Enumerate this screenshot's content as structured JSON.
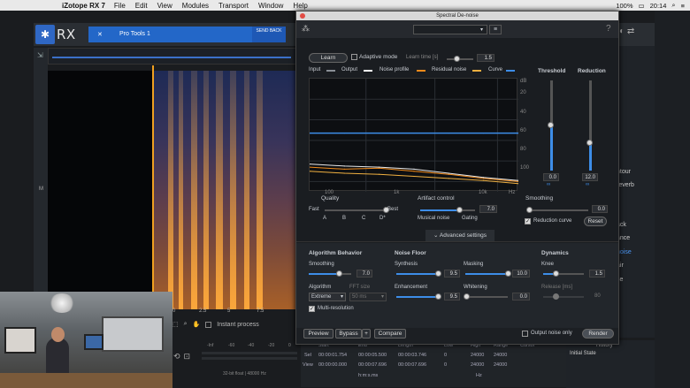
{
  "menubar": {
    "app": "iZotope RX 7",
    "items": [
      "File",
      "Edit",
      "View",
      "Modules",
      "Transport",
      "Window",
      "Help"
    ],
    "battery": "100%",
    "time": "20:14"
  },
  "rx": {
    "logo": "RX",
    "tab_close": "✕",
    "tab_name": "Pro Tools 1",
    "send_back": "SEND BACK",
    "track_label": "M",
    "timeline": [
      "0",
      "2.5",
      "5",
      "7.5",
      "10",
      "12.5",
      "15",
      "17.5",
      "20"
    ],
    "instant_process": "Instant process",
    "format": "32-bit float | 48000 Hz",
    "meter_labels": [
      "-Inf",
      "-60",
      "-40",
      "-20",
      "0"
    ]
  },
  "rightpanel": {
    "items": [
      "ntour",
      "reverb",
      "ack",
      "ance",
      "noise",
      "air",
      "se"
    ],
    "history_label": "History",
    "history_item": "Initial State",
    "cursor_label": "Cursor"
  },
  "selection": {
    "headers": [
      "Start",
      "End",
      "Length",
      "Low",
      "High",
      "Range"
    ],
    "sel": [
      "Sel",
      "00:00:01.754",
      "00:00:05.500",
      "00:00:03.746",
      "0",
      "24000",
      "24000"
    ],
    "view": [
      "View",
      "00:00:00.000",
      "00:00:07.696",
      "00:00:07.696",
      "0",
      "24000",
      "24000"
    ],
    "units": "h:m:s.ms",
    "hz": "Hz"
  },
  "dialog": {
    "title": "Spectral De-noise",
    "help": "?",
    "learn": "Learn",
    "adaptive": "Adaptive mode",
    "learn_time_label": "Learn time [s]",
    "learn_time": "1.5",
    "legend": [
      {
        "name": "Input",
        "color": "#8a8f96"
      },
      {
        "name": "Output",
        "color": "#ffffff"
      },
      {
        "name": "Noise profile",
        "color": "#f08a1a"
      },
      {
        "name": "Residual noise",
        "color": "#f0b040"
      },
      {
        "name": "Curve",
        "color": "#3d8de8"
      }
    ],
    "threshold_label": "Threshold",
    "threshold": "0.0",
    "reduction_label": "Reduction",
    "reduction": "12.0",
    "db_ticks": [
      "dB",
      "20",
      "40",
      "60",
      "80",
      "100"
    ],
    "hz_ticks": [
      "100",
      "1k",
      "10k",
      "Hz"
    ],
    "quality_label": "Quality",
    "fast": "Fast",
    "best": "Best",
    "quality_marks": [
      "A",
      "B",
      "C",
      "D*"
    ],
    "artifact_label": "Artifact control",
    "artifact": "7.0",
    "musical_noise": "Musical noise",
    "gating": "Gating",
    "smoothing_label": "Smoothing",
    "smoothing": "0.0",
    "reduction_curve": "Reduction curve",
    "reset": "Reset",
    "advanced": "Advanced settings",
    "alg_behavior": "Algorithm Behavior",
    "adv_smoothing": "Smoothing",
    "adv_smoothing_val": "7.0",
    "algorithm_label": "Algorithm",
    "algorithm": "Extreme",
    "fft_label": "FFT size",
    "fft": "50 ms",
    "multi_res": "Multi-resolution",
    "noise_floor": "Noise Floor",
    "synthesis": "Synthesis",
    "synthesis_val": "9.5",
    "masking": "Masking",
    "masking_val": "10.0",
    "enhancement": "Enhancement",
    "enhancement_val": "9.5",
    "whitening": "Whitening",
    "whitening_val": "0.0",
    "dynamics": "Dynamics",
    "knee": "Knee",
    "knee_val": "1.5",
    "release": "Release [ms]",
    "release_val": "80",
    "preview": "Preview",
    "bypass": "Bypass",
    "plus": "+",
    "compare": "Compare",
    "output_noise_only": "Output noise only",
    "render": "Render"
  },
  "chart_data": {
    "type": "line",
    "title": "",
    "xlabel": "",
    "ylabel": "dB",
    "x_ticks": [
      "100",
      "1k",
      "10k",
      "Hz"
    ],
    "y_ticks": [
      "20",
      "40",
      "60",
      "80",
      "100"
    ],
    "series": [
      {
        "name": "Curve",
        "values": [
          53,
          53,
          53,
          53,
          53,
          53,
          53
        ]
      },
      {
        "name": "Noise profile",
        "values": [
          86,
          88,
          87,
          90,
          93,
          97,
          100
        ]
      },
      {
        "name": "Residual noise",
        "values": [
          90,
          92,
          93,
          95,
          97,
          99,
          102
        ]
      },
      {
        "name": "Output",
        "values": [
          83,
          85,
          86,
          88,
          92,
          96,
          99
        ]
      }
    ]
  }
}
